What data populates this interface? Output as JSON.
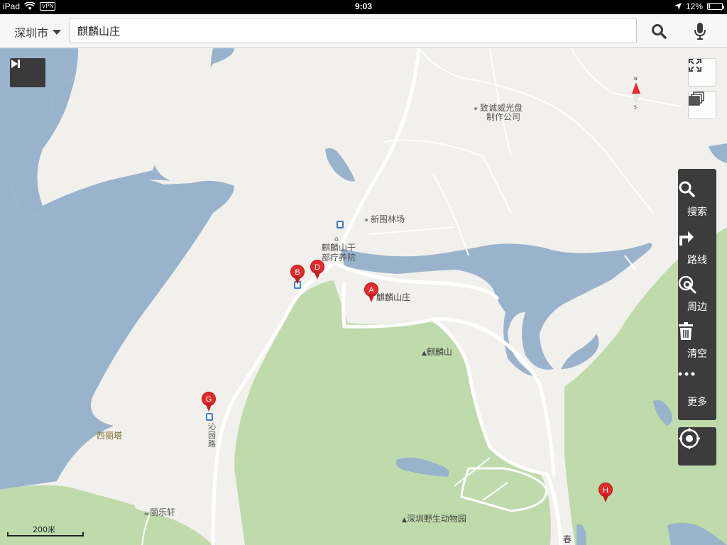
{
  "status_bar": {
    "device": "iPad",
    "vpn": "VPN",
    "time": "9:03",
    "battery": "12%",
    "battery_level": 0.12
  },
  "search": {
    "city": "深圳市",
    "query": "麒麟山庄"
  },
  "map": {
    "labels": {
      "zhicheng": "致诚威光盘",
      "zhicheng2": "制作公司",
      "xinwei": "新围林场",
      "qilin_ganbu1": "麒麟山干",
      "qilin_ganbu2": "部疗养院",
      "qilin_shanzhuang": "麒麟山庄",
      "qilin_shan": "麒麟山",
      "xilita": "西丽塔",
      "qinyuan_lu": "沁园路",
      "lilexuan": "丽乐轩",
      "zoo": "深圳野生动物园",
      "chun": "春"
    },
    "pins": [
      "A",
      "B",
      "D",
      "G",
      "H"
    ],
    "scale_label": "200米",
    "compass": {
      "n": "N",
      "s": "S"
    }
  },
  "side_panel": {
    "search": "搜索",
    "route": "路线",
    "nearby": "周边",
    "clear": "清空",
    "more": "更多"
  },
  "colors": {
    "water": "#99b3cc",
    "land": "#f2f0ec",
    "park": "#bfdbab",
    "pin": "#e32b2b",
    "panel": "#3c3c3c"
  }
}
